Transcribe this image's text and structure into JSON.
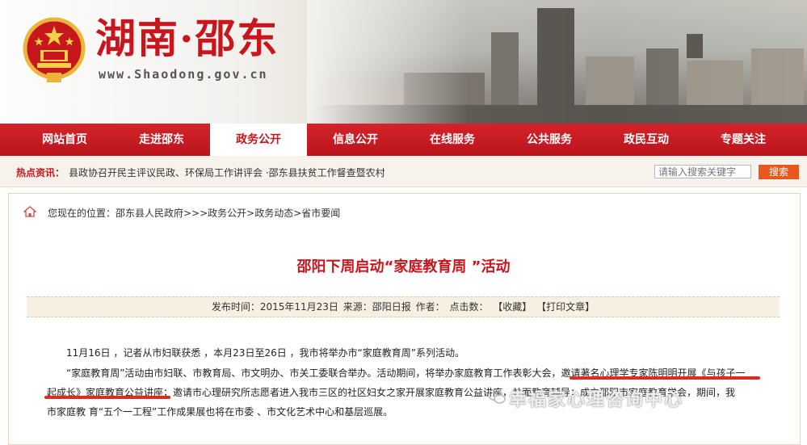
{
  "header": {
    "title": "湖南·邵东",
    "url": "www.Shaodong.gov.cn"
  },
  "nav": {
    "items": [
      {
        "label": "网站首页"
      },
      {
        "label": "走进邵东"
      },
      {
        "label": "政务公开"
      },
      {
        "label": "信息公开"
      },
      {
        "label": "在线服务"
      },
      {
        "label": "公共服务"
      },
      {
        "label": "政民互动"
      },
      {
        "label": "专题关注"
      }
    ],
    "active_index": 2
  },
  "hot": {
    "label": "热点资讯：",
    "text": "县政协召开民主评议民政、环保局工作讲评会  ·邵东县扶贫工作督查暨农村"
  },
  "search": {
    "placeholder": "请输入搜索关键字",
    "button_label": "搜索"
  },
  "breadcrumb": "您现在的位置：邵东县人民政府>>>政务公开>政务动态>省市要闻",
  "article": {
    "title": "邵阳下周启动“家庭教育周 ”活动",
    "meta": {
      "published": "发布时间：2015年11月23日",
      "source": "来源：邵阳日报",
      "author": "作者：",
      "clicks": "点击数：",
      "favorite": "【收藏】",
      "print": "【打印文章】"
    },
    "lines": [
      "11月16日 ，记者从市妇联获悉 ，本月23日至26日 ，我市将举办市“家庭教育周”系列活动。",
      "“家庭教育周”活动由市妇联、市教育局、市文明办、市关工委联合举办。活动期间，将举办家庭教育工作表彰大会，邀请著名心理学专家陈明明开展《与孩子一",
      "起成长》家庭教育公益讲座；邀请市心理研究所志愿者进入我市三区的社区妇女之家开展家庭教育公益讲座，并面教育辅导；成立邵阳市家庭教育学会，期间，我",
      "市家庭教 育“五个一工程”工作成果展也将在市委 、市文化艺术中心和基层巡展。"
    ]
  },
  "watermark": "幸福家心理咨询中心",
  "colors": {
    "brand_red": "#c8161d",
    "search_orange": "#e8581c",
    "underline_red": "#e02a22"
  }
}
